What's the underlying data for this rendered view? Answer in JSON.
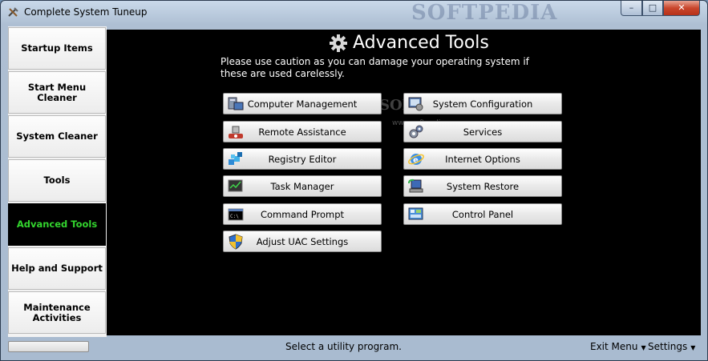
{
  "window": {
    "title": "Complete System Tuneup",
    "watermark": "SOFTPEDIA",
    "controls": {
      "minimize": "–",
      "maximize": "□",
      "close": "✕"
    }
  },
  "sidebar": {
    "items": [
      {
        "label": "Startup Items"
      },
      {
        "label": "Start Menu Cleaner"
      },
      {
        "label": "System Cleaner"
      },
      {
        "label": "Tools"
      },
      {
        "label": "Advanced Tools"
      },
      {
        "label": "Help and Support"
      },
      {
        "label": "Maintenance Activities"
      }
    ],
    "active_index": 4,
    "active_color": "#33d52e"
  },
  "main": {
    "heading": "Advanced Tools",
    "heading_icon": "gear-icon",
    "caution": "Please use caution as you can damage your operating system if these are used carelessly.",
    "watermark": "SOFTPEDIA",
    "watermark_sub": "www.softpedia.com",
    "tools_left": [
      {
        "label": "Computer Management",
        "icon": "computer-management-icon"
      },
      {
        "label": "Remote Assistance",
        "icon": "remote-assistance-icon"
      },
      {
        "label": "Registry Editor",
        "icon": "registry-editor-icon"
      },
      {
        "label": "Task Manager",
        "icon": "task-manager-icon"
      },
      {
        "label": "Command Prompt",
        "icon": "command-prompt-icon"
      },
      {
        "label": "Adjust UAC Settings",
        "icon": "uac-shield-icon"
      }
    ],
    "tools_right": [
      {
        "label": "System Configuration",
        "icon": "system-configuration-icon"
      },
      {
        "label": "Services",
        "icon": "services-gears-icon"
      },
      {
        "label": "Internet Options",
        "icon": "internet-explorer-icon"
      },
      {
        "label": "System Restore",
        "icon": "system-restore-icon"
      },
      {
        "label": "Control Panel",
        "icon": "control-panel-icon"
      }
    ]
  },
  "statusbar": {
    "status": "Select a utility program.",
    "exit_menu": "Exit Menu",
    "settings": "Settings"
  }
}
